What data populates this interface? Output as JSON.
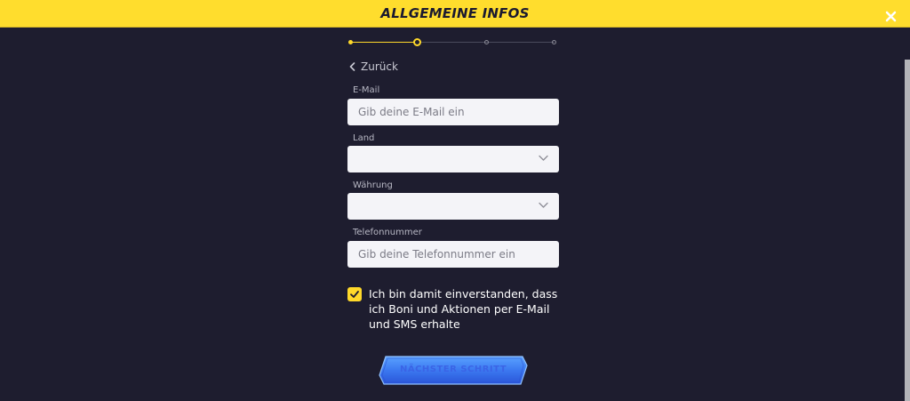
{
  "header": {
    "title": "ALLGEMEINE INFOS",
    "background": "#ffdd2d"
  },
  "stepper": {
    "total_steps": 4,
    "current_step": 2,
    "active_color": "#ffd92a",
    "inactive_color": "#8a8a96"
  },
  "back": {
    "label": "Zurück"
  },
  "form": {
    "email": {
      "label": "E-Mail",
      "placeholder": "Gib deine E-Mail ein",
      "value": ""
    },
    "country": {
      "label": "Land",
      "value": ""
    },
    "currency": {
      "label": "Währung",
      "value": ""
    },
    "phone": {
      "label": "Telefonnummer",
      "placeholder": "Gib deine Telefonnummer ein",
      "value": ""
    }
  },
  "consent": {
    "checked": true,
    "text": "Ich bin damit einverstanden, dass ich Boni und Aktionen per E-Mail und SMS erhalte"
  },
  "next_button": {
    "label": "NÄCHSTER SCHRITT",
    "color": "#2f5fe0"
  }
}
